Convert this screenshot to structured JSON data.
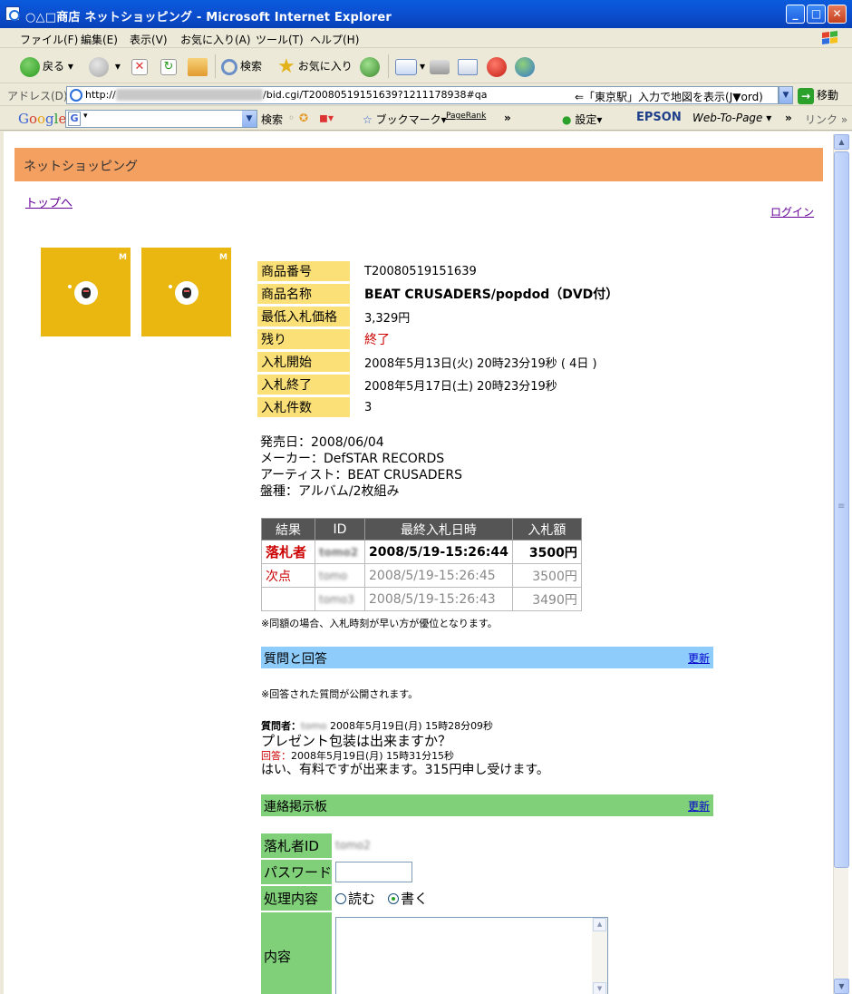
{
  "window": {
    "title": "○△□商店 ネットショッピング - Microsoft Internet Explorer"
  },
  "menu": [
    "ファイル(F)",
    "編集(E)",
    "表示(V)",
    "お気に入り(A)",
    "ツール(T)",
    "ヘルプ(H)"
  ],
  "toolbar": {
    "back_label": "戻る",
    "search_label": "検索",
    "favorites_label": "お気に入り"
  },
  "address": {
    "label": "アドレス(D)",
    "url_prefix": "http://",
    "url_suffix": "/bid.cgi/T20080519151639?1211178938#qa",
    "hint": "⇐「東京駅」入力で地図を表示(J▼ord)",
    "go_label": "移動"
  },
  "googlebar": {
    "search_label": "検索",
    "bookmarks_label": "ブックマーク▾",
    "pagerank_label": "PageRank",
    "settings_label": "設定▾",
    "epson_label": "EPSON",
    "webtopage_label": "Web-To-Page",
    "links_label": "リンク"
  },
  "page": {
    "header_title": "ネットショッピング",
    "top_link": "トップへ",
    "login_link": "ログイン"
  },
  "product": {
    "rows": [
      {
        "label": "商品番号",
        "value": "T20080519151639"
      },
      {
        "label": "商品名称",
        "value": "BEAT CRUSADERS/popdod（DVD付）"
      },
      {
        "label": "最低入札価格",
        "value": "3,329円"
      },
      {
        "label": "残り",
        "value": "終了"
      },
      {
        "label": "入札開始",
        "value": "2008年5月13日(火) 20時23分19秒 ( 4日 )"
      },
      {
        "label": "入札終了",
        "value": "2008年5月17日(土) 20時23分19秒"
      },
      {
        "label": "入札件数",
        "value": "3"
      }
    ],
    "specs": [
      "発売日：2008/06/04",
      "メーカー：DefSTAR RECORDS",
      "アーティスト：BEAT CRUSADERS",
      "盤種：アルバム/2枚組み"
    ]
  },
  "bids": {
    "headers": [
      "結果",
      "ID",
      "最終入札日時",
      "入札額"
    ],
    "rows": [
      {
        "result": "落札者",
        "id": "tomo2",
        "datetime": "2008/5/19-15:26:44",
        "amount": "3500円"
      },
      {
        "result": "次点",
        "id": "tomo",
        "datetime": "2008/5/19-15:26:45",
        "amount": "3500円"
      },
      {
        "result": "",
        "id": "tomo3",
        "datetime": "2008/5/19-15:26:43",
        "amount": "3490円"
      }
    ],
    "note": "※同額の場合、入札時刻が早い方が優位となります。"
  },
  "qa": {
    "title": "質問と回答",
    "update_label": "更新",
    "note": "※回答された質問が公開されます。",
    "question_label": "質問者：",
    "question_user": "tomo",
    "question_time": "2008年5月19日(月) 15時28分09秒",
    "question_text": "プレゼント包装は出来ますか？",
    "answer_label": "回答：",
    "answer_time": "2008年5月19日(月) 15時31分15秒",
    "answer_text": "はい、有料ですが出来ます。315円申し受けます。"
  },
  "board": {
    "title": "連絡掲示板",
    "update_label": "更新",
    "winner_label": "落札者ID",
    "winner_id": "tomo2",
    "password_label": "パスワード",
    "action_label": "処理内容",
    "read_label": "読む",
    "write_label": "書く",
    "content_label": "内容"
  }
}
